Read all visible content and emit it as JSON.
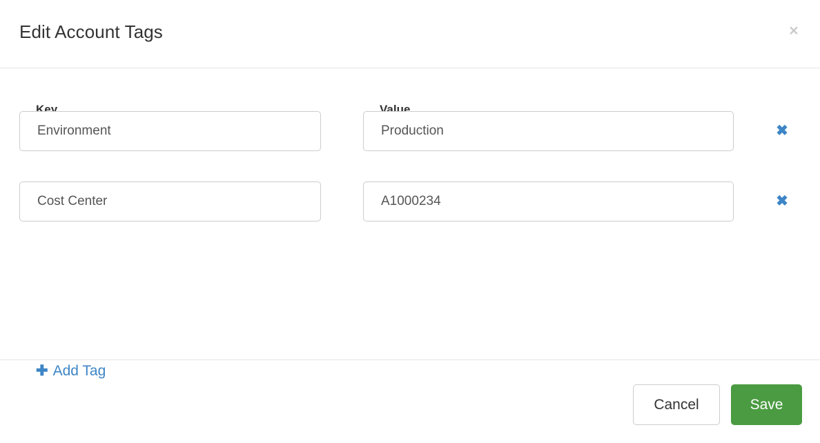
{
  "dialog": {
    "title": "Edit Account Tags",
    "close_icon": "close-icon",
    "close_label": "×"
  },
  "table": {
    "headers": {
      "key": "Key",
      "value": "Value"
    },
    "rows": [
      {
        "key": "Environment",
        "value": "Production",
        "key_placeholder": "Key",
        "value_placeholder": "Value",
        "remove_icon": "remove-icon",
        "remove_label": "✖"
      },
      {
        "key": "Cost Center",
        "value": "A1000234",
        "key_placeholder": "Key",
        "value_placeholder": "Value",
        "remove_icon": "remove-icon",
        "remove_label": "✖"
      }
    ]
  },
  "add_tag": {
    "icon": "plus-icon",
    "icon_glyph": "✚",
    "label": "Add Tag"
  },
  "footer": {
    "cancel_label": "Cancel",
    "save_label": "Save"
  },
  "colors": {
    "accent_blue": "#3d85c6",
    "save_green": "#4a9b41",
    "border_gray": "#cccccc",
    "divider_gray": "#e5e5e5",
    "close_gray": "#cccccc",
    "text_dark": "#333333",
    "field_text": "#555555"
  }
}
